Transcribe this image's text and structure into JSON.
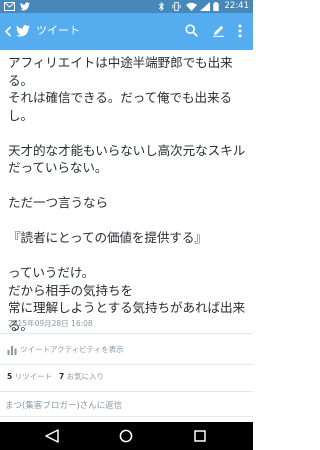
{
  "status_bar": {
    "time": "22:41",
    "icons": [
      "mail-icon",
      "twitter-icon",
      "bluetooth-icon",
      "vibrate-icon",
      "wifi-icon",
      "signal-icon",
      "battery-icon"
    ]
  },
  "app_bar": {
    "title": "ツイート",
    "color": "#55acee",
    "icons": [
      "back-arrow-icon",
      "twitter-bird-icon",
      "search-icon",
      "compose-icon",
      "overflow-menu-icon"
    ]
  },
  "tweet": {
    "lines": [
      "アフィリエイトは中途半端野郎でも出来",
      "る。",
      "それは確信できる。だって俺でも出来る",
      "し。",
      "",
      "天才的な才能もいらないし高次元なスキル",
      "だっていらない。",
      "",
      "ただ一つ言うなら",
      "",
      "『読者にとっての価値を提供する』",
      "",
      "っていうだけ。",
      "だから相手の気持ちを",
      "常に理解しようとする気持ちがあれば出来",
      "る。"
    ],
    "timestamp": "2015年09月28日 16:08"
  },
  "activity": {
    "label": "ツイートアクティビティを表示",
    "icon": "bar-chart-icon"
  },
  "stats": {
    "retweets_count": "5",
    "retweets_label": "リツイート",
    "likes_count": "7",
    "likes_label": "お気に入り"
  },
  "reply": {
    "placeholder": "まつ(集客ブロガー)さんに返信"
  },
  "nav_bar": {
    "icons": [
      "back-triangle-icon",
      "home-circle-icon",
      "recents-square-icon"
    ]
  }
}
